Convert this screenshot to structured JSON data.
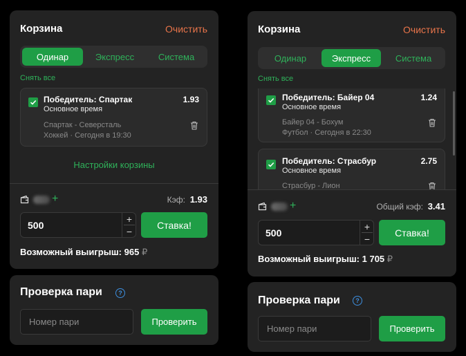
{
  "left": {
    "cart": {
      "title": "Корзина",
      "clear": "Очистить",
      "tabs": [
        "Одинар",
        "Экспресс",
        "Система"
      ],
      "active_tab": 0,
      "unselect_all": "Снять все",
      "bets": [
        {
          "title": "Победитель: Спартак",
          "period": "Основное время",
          "odd": "1.93",
          "event": "Спартак - Северсталь",
          "info": "Хоккей · Сегодня в 19:30",
          "checked": true
        }
      ],
      "settings": "Настройки корзины",
      "coef_label": "Кэф:",
      "coef_value": "1.93",
      "stake": "500",
      "stake_button": "Ставка!",
      "win_label": "Возможный выигрыш:",
      "win_value": "965",
      "currency": "₽"
    },
    "check": {
      "title": "Проверка пари",
      "placeholder": "Номер пари",
      "button": "Проверить"
    }
  },
  "right": {
    "cart": {
      "title": "Корзина",
      "clear": "Очистить",
      "tabs": [
        "Одинар",
        "Экспресс",
        "Система"
      ],
      "active_tab": 1,
      "unselect_all": "Снять все",
      "bets": [
        {
          "title": "Победитель: Байер 04",
          "period": "Основное время",
          "odd": "1.24",
          "event": "Байер 04 - Бохум",
          "info": "Футбол · Сегодня в 22:30",
          "checked": true
        },
        {
          "title": "Победитель: Страсбур",
          "period": "Основное время",
          "odd": "2.75",
          "event": "Страсбур - Лион",
          "info": "",
          "checked": true
        }
      ],
      "coef_label": "Общий кэф:",
      "coef_value": "3.41",
      "stake": "500",
      "stake_button": "Ставка!",
      "win_label": "Возможный выигрыш:",
      "win_value": "1 705",
      "currency": "₽"
    },
    "check": {
      "title": "Проверка пари",
      "placeholder": "Номер пари",
      "button": "Проверить"
    }
  },
  "icons": {
    "checkbox": "checkmark-icon",
    "delete": "trash-icon",
    "wallet": "wallet-icon",
    "add": "plus-icon",
    "info": "info-icon",
    "increment": "plus-icon",
    "decrement": "minus-icon"
  },
  "colors": {
    "accent": "#1f9e46",
    "link_green": "#2fb25a",
    "clear_orange": "#e8744a",
    "panel": "#232323",
    "info_blue": "#3d8fe0"
  }
}
